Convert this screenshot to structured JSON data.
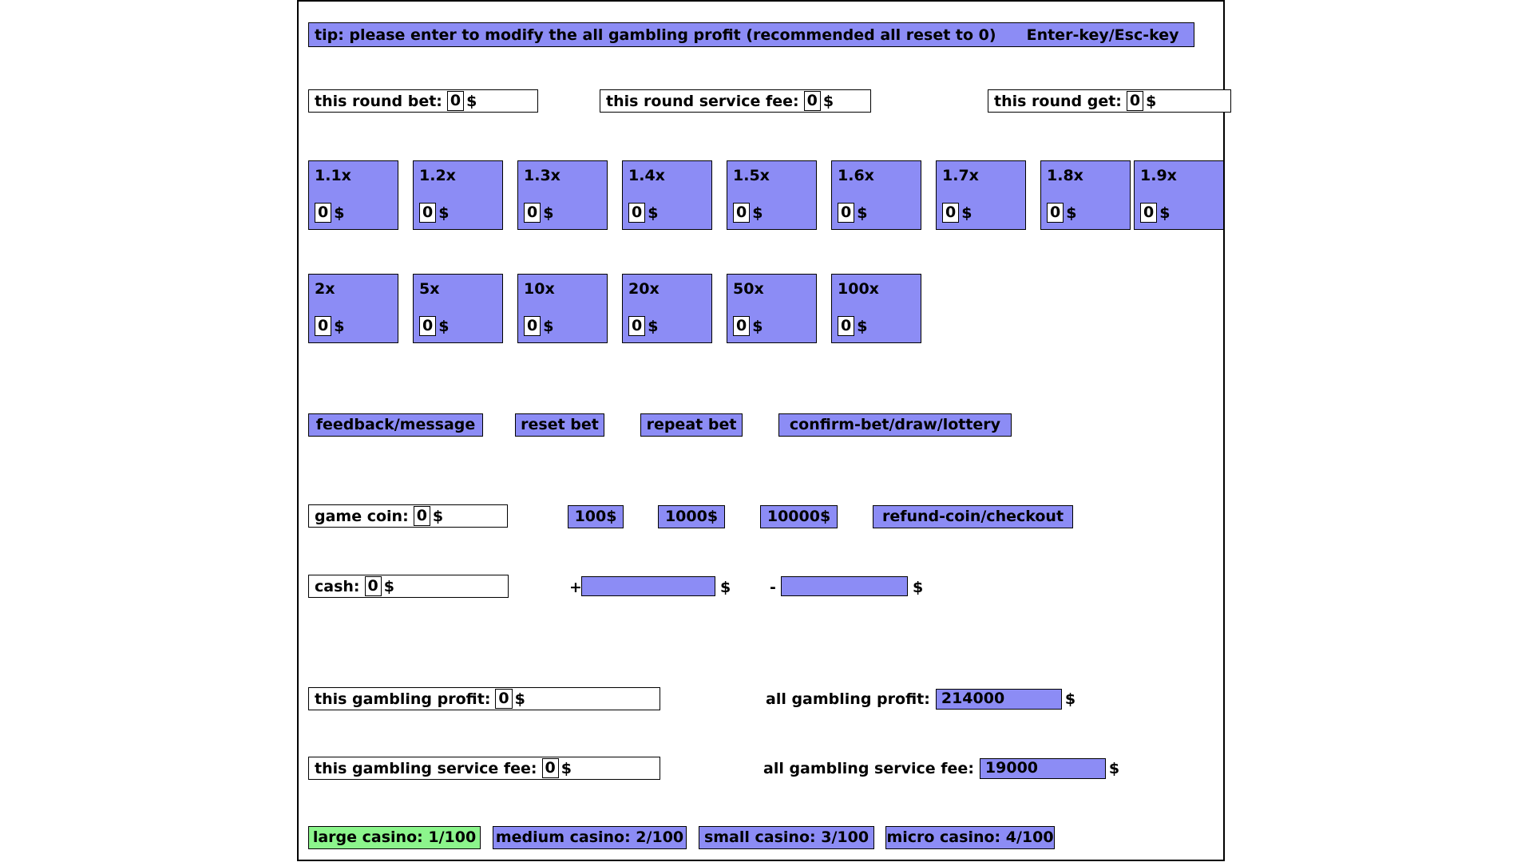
{
  "tip": {
    "text": "tip: please enter to modify the all gambling profit (recommended all reset to 0)",
    "keys": "Enter-key/Esc-key"
  },
  "round": {
    "bet": {
      "label": "this round bet:",
      "value": "0",
      "unit": "$"
    },
    "service_fee": {
      "label": "this round service fee:",
      "value": "0",
      "unit": "$"
    },
    "get": {
      "label": "this round get:",
      "value": "0",
      "unit": "$"
    }
  },
  "multiplier_tiles_row1": [
    {
      "mult": "1.1x",
      "value": "0",
      "unit": "$"
    },
    {
      "mult": "1.2x",
      "value": "0",
      "unit": "$"
    },
    {
      "mult": "1.3x",
      "value": "0",
      "unit": "$"
    },
    {
      "mult": "1.4x",
      "value": "0",
      "unit": "$"
    },
    {
      "mult": "1.5x",
      "value": "0",
      "unit": "$"
    },
    {
      "mult": "1.6x",
      "value": "0",
      "unit": "$"
    },
    {
      "mult": "1.7x",
      "value": "0",
      "unit": "$"
    },
    {
      "mult": "1.8x",
      "value": "0",
      "unit": "$"
    },
    {
      "mult": "1.9x",
      "value": "0",
      "unit": "$"
    }
  ],
  "multiplier_tiles_row2": [
    {
      "mult": "2x",
      "value": "0",
      "unit": "$"
    },
    {
      "mult": "5x",
      "value": "0",
      "unit": "$"
    },
    {
      "mult": "10x",
      "value": "0",
      "unit": "$"
    },
    {
      "mult": "20x",
      "value": "0",
      "unit": "$"
    },
    {
      "mult": "50x",
      "value": "0",
      "unit": "$"
    },
    {
      "mult": "100x",
      "value": "0",
      "unit": "$"
    }
  ],
  "actions": {
    "feedback": "feedback/message",
    "reset_bet": "reset bet",
    "repeat_bet": "repeat bet",
    "confirm": "confirm-bet/draw/lottery"
  },
  "coin": {
    "game_coin": {
      "label": "game coin:",
      "value": "0",
      "unit": "$"
    },
    "quick_100": "100$",
    "quick_1000": "1000$",
    "quick_10000": "10000$",
    "refund": "refund-coin/checkout"
  },
  "cash": {
    "label": "cash:",
    "value": "0",
    "unit": "$",
    "plus_sign": "+",
    "plus_value": "",
    "plus_unit": "$",
    "minus_sign": "-",
    "minus_value": "",
    "minus_unit": "$"
  },
  "profit": {
    "this_profit": {
      "label": "this gambling profit:",
      "value": "0",
      "unit": "$"
    },
    "all_profit": {
      "label": "all gambling profit:",
      "value": "214000",
      "unit": "$"
    },
    "this_service_fee": {
      "label": "this gambling service fee:",
      "value": "0",
      "unit": "$"
    },
    "all_service_fee": {
      "label": "all gambling service fee:",
      "value": "19000",
      "unit": "$"
    }
  },
  "casinos": [
    {
      "label": "large casino: 1/100",
      "selected": true
    },
    {
      "label": "medium casino: 2/100",
      "selected": false
    },
    {
      "label": "small casino: 3/100",
      "selected": false
    },
    {
      "label": "micro casino: 4/100",
      "selected": false
    }
  ],
  "colors": {
    "accent_blue": "#8c8cf5",
    "selected_green": "#8cf58c",
    "border": "#000000",
    "background": "#ffffff"
  }
}
